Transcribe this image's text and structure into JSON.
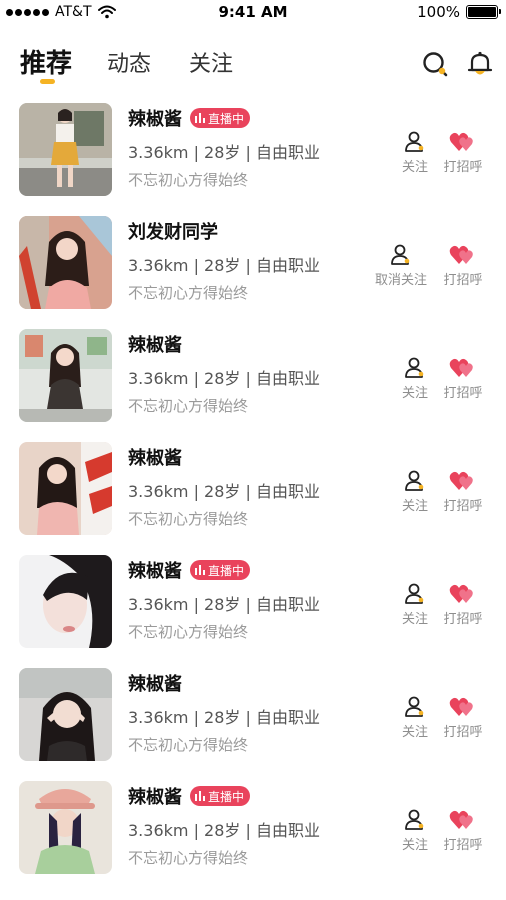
{
  "status_bar": {
    "carrier": "AT&T",
    "time": "9:41 AM",
    "battery": "100%"
  },
  "header": {
    "tabs": [
      {
        "label": "推荐",
        "active": true
      },
      {
        "label": "动态",
        "active": false
      },
      {
        "label": "关注",
        "active": false
      }
    ],
    "icons": [
      "search-icon",
      "bell-icon"
    ],
    "accent_color": "#f5b323"
  },
  "live_badge_color": "#e9435c",
  "users": [
    {
      "name": "辣椒酱",
      "live": true,
      "live_label": "直播中",
      "meta": "3.36km | 28岁 | 自由职业",
      "bio": "不忘初心方得始终",
      "follow_label": "关注",
      "greet_label": "打招呼"
    },
    {
      "name": "刘发财同学",
      "live": false,
      "live_label": "",
      "meta": "3.36km | 28岁 | 自由职业",
      "bio": "不忘初心方得始终",
      "follow_label": "取消关注",
      "greet_label": "打招呼"
    },
    {
      "name": "辣椒酱",
      "live": false,
      "live_label": "",
      "meta": "3.36km | 28岁 | 自由职业",
      "bio": "不忘初心方得始终",
      "follow_label": "关注",
      "greet_label": "打招呼"
    },
    {
      "name": "辣椒酱",
      "live": false,
      "live_label": "",
      "meta": "3.36km | 28岁 | 自由职业",
      "bio": "不忘初心方得始终",
      "follow_label": "关注",
      "greet_label": "打招呼"
    },
    {
      "name": "辣椒酱",
      "live": true,
      "live_label": "直播中",
      "meta": "3.36km | 28岁 | 自由职业",
      "bio": "不忘初心方得始终",
      "follow_label": "关注",
      "greet_label": "打招呼"
    },
    {
      "name": "辣椒酱",
      "live": false,
      "live_label": "",
      "meta": "3.36km | 28岁 | 自由职业",
      "bio": "不忘初心方得始终",
      "follow_label": "关注",
      "greet_label": "打招呼"
    },
    {
      "name": "辣椒酱",
      "live": true,
      "live_label": "直播中",
      "meta": "3.36km | 28岁 | 自由职业",
      "bio": "不忘初心方得始终",
      "follow_label": "关注",
      "greet_label": "打招呼"
    }
  ]
}
